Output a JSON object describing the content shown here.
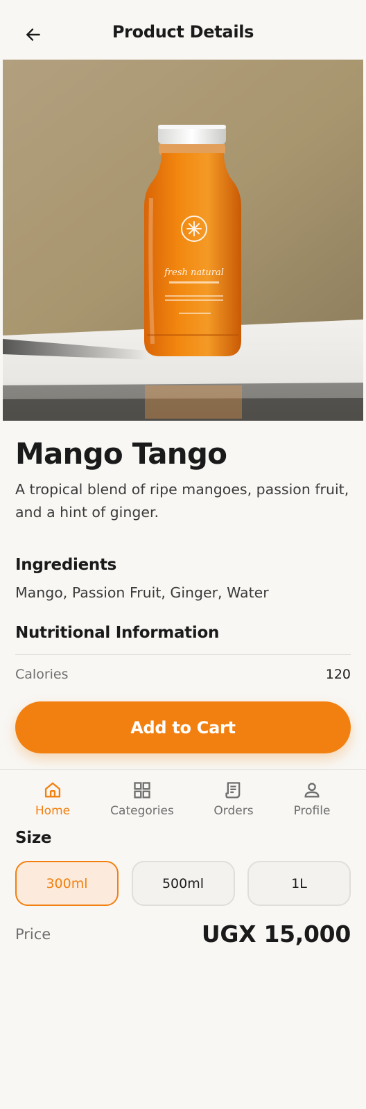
{
  "header": {
    "title": "Product Details",
    "back_icon": "arrow-left-icon"
  },
  "hero": {
    "image_description": "orange juice bottle",
    "label_brand": "fresh natural",
    "accent_color": "#f28010"
  },
  "product": {
    "name": "Mango Tango",
    "description": "A tropical blend of ripe mangoes, passion fruit, and a hint of ginger."
  },
  "ingredients": {
    "title": "Ingredients",
    "text": "Mango, Passion Fruit, Ginger, Water"
  },
  "nutrition": {
    "title": "Nutritional Information",
    "rows": [
      {
        "label": "Calories",
        "value": "120"
      }
    ]
  },
  "cart": {
    "add_label": "Add to Cart"
  },
  "nav": {
    "items": [
      {
        "label": "Home",
        "icon": "home-icon",
        "active": true
      },
      {
        "label": "Categories",
        "icon": "grid-icon",
        "active": false
      },
      {
        "label": "Orders",
        "icon": "receipt-icon",
        "active": false
      },
      {
        "label": "Profile",
        "icon": "user-icon",
        "active": false
      }
    ]
  },
  "size": {
    "title": "Size",
    "options": [
      {
        "label": "300ml",
        "selected": true
      },
      {
        "label": "500ml",
        "selected": false
      },
      {
        "label": "1L",
        "selected": false
      }
    ]
  },
  "price": {
    "label": "Price",
    "value": "UGX 15,000"
  },
  "colors": {
    "accent": "#f28010",
    "background": "#f8f7f4",
    "text": "#1a1a1a"
  }
}
